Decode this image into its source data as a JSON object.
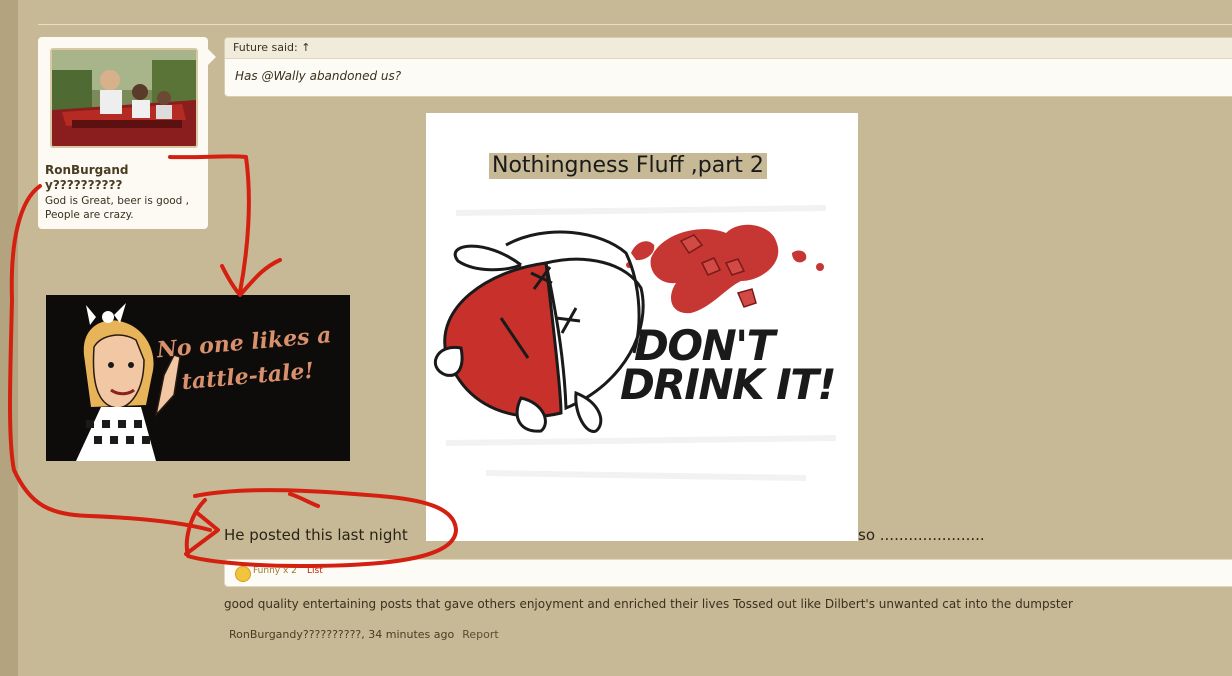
{
  "user": {
    "name": "RonBurgandy??????????",
    "title": "God is Great, beer is good , People are crazy."
  },
  "quote": {
    "header": "Future said: ↑",
    "text": "Has @Wally abandoned us?"
  },
  "post": {
    "image_title": "Nothingness Fluff ,part 2",
    "image_caption_line1": "DON'T",
    "image_caption_line2": "DRINK IT!",
    "tattle_line1": "No one likes a",
    "tattle_line2": "tattle-tale!",
    "text_start": "He posted this last night",
    "text_end": "so ......................"
  },
  "rating": {
    "label": "Funny x 2",
    "list": "List"
  },
  "signature": "good quality entertaining posts that gave others enjoyment and enriched their lives Tossed out like Dilbert's unwanted cat into the dumpster",
  "meta": {
    "author_time": "RonBurgandy??????????, 34 minutes ago",
    "report": "Report"
  },
  "colors": {
    "background": "#c7b995",
    "card": "#fcfaf3",
    "annotation_red": "#d42010"
  }
}
